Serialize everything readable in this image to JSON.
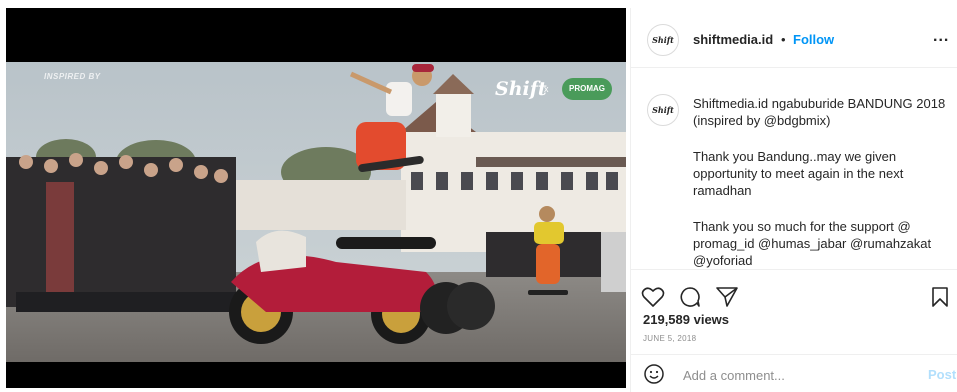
{
  "video": {
    "watermark_inspired": "INSPIRED BY",
    "watermark_shift": "Shift",
    "watermark_x": "x",
    "watermark_promag": "PROMAG",
    "mute_icon": "speaker-muted-icon"
  },
  "post": {
    "username": "shiftmedia.id",
    "separator": "•",
    "follow_label": "Follow",
    "more_label": "...",
    "avatar_text": "Shift",
    "caption": {
      "line1": "Shiftmedia.id ngabuburide BANDUNG 2018\n(inspired by @bdgbmix)",
      "line2": "Thank you Bandung..may we given\nopportunity to meet again in the next\nramadhan",
      "line3": "Thank you so much for the support @\npromag_id @humas_jabar @rumahzakat\n@yoforiad"
    },
    "views": "219,589 views",
    "date": "JUNE 5, 2018",
    "comment_placeholder": "Add a comment...",
    "post_label": "Post"
  },
  "icons": {
    "like": "heart-icon",
    "comment": "comment-icon",
    "share": "share-icon",
    "save": "bookmark-icon",
    "emoji": "emoji-icon"
  },
  "colors": {
    "follow": "#0095f6",
    "post_disabled": "#b2dffc",
    "text": "#262626",
    "muted": "#8e8e8e"
  }
}
